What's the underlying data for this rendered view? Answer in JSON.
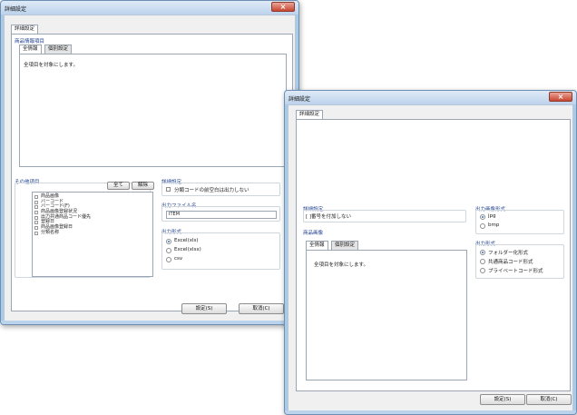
{
  "windowA": {
    "title": "詳細設定",
    "tab": "詳細設定",
    "product_group_label": "商品情報項目",
    "subtabs": [
      "全情報",
      "個別設定"
    ],
    "all_items_text": "全項目を対象にします。",
    "other_group_label": "その他項目",
    "all_button": "全て",
    "clear_button": "解除",
    "other_items": [
      "商品画像",
      "バーコード",
      "バーコード(F)",
      "商品画像登録状況",
      "出力共通商品コード優先",
      "登録日",
      "商品画像登録日",
      "分類名称"
    ],
    "detail_label": "詳細設定",
    "detail_checkbox": "分類コードの前空白は出力しない",
    "filename_label": "出力ファイル名",
    "filename_value": "ITEM",
    "format_label": "出力形式",
    "formats": [
      "Excel(xls)",
      "Excel(xlsx)",
      "csv"
    ],
    "ok_button": "設定(S)",
    "cancel_button": "取消(C)"
  },
  "windowB": {
    "title": "詳細設定",
    "tab": "詳細設定",
    "detail_label": "詳細設定",
    "serial_checkbox": "[ ]番号を付加しない",
    "product_image_label": "商品画像",
    "subtabs": [
      "全情報",
      "個別設定"
    ],
    "all_items_text": "全項目を対象にします。",
    "img_format_label": "出力画像形式",
    "img_formats": [
      "jpg",
      "bmp"
    ],
    "out_format_label": "出力形式",
    "out_formats": [
      "フォルダー化形式",
      "共通商品コード形式",
      "プライベートコード形式"
    ],
    "ok_button": "設定(S)",
    "cancel_button": "取消(C)"
  },
  "colors": {
    "accent": "#1d3f8f",
    "close": "#c9452f",
    "frame": "#aacbe8"
  }
}
